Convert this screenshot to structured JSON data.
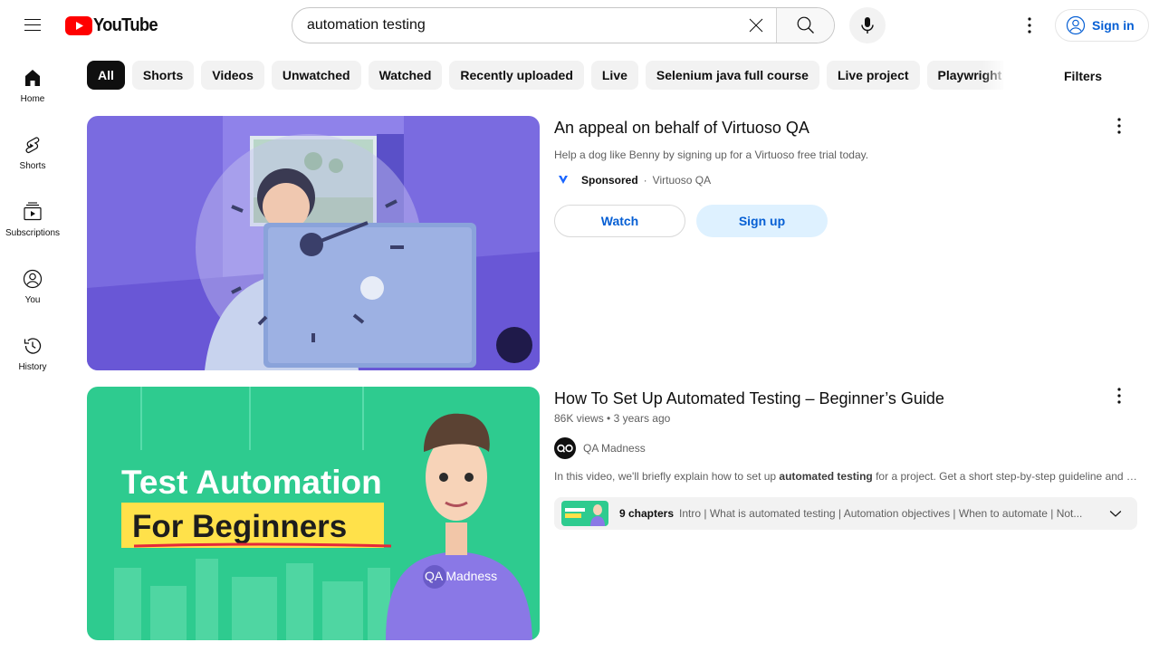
{
  "masthead": {
    "menu_icon": "hamburger-menu-icon",
    "logo_text": "YouTube",
    "brand_color": "#ff0000",
    "search": {
      "value": "automation testing",
      "placeholder": "Search"
    },
    "sign_in_label": "Sign in"
  },
  "guide": {
    "items": [
      {
        "label": "Home",
        "icon": "home-icon"
      },
      {
        "label": "Shorts",
        "icon": "shorts-icon"
      },
      {
        "label": "Subscriptions",
        "icon": "subscriptions-icon"
      },
      {
        "label": "You",
        "icon": "you-icon"
      },
      {
        "label": "History",
        "icon": "history-icon"
      }
    ]
  },
  "chips": [
    "All",
    "Shorts",
    "Videos",
    "Unwatched",
    "Watched",
    "Recently uploaded",
    "Live",
    "Selenium java full course",
    "Live project",
    "Playwright"
  ],
  "active_chip": "All",
  "filters_label": "Filters",
  "results": {
    "ad": {
      "title": "An appeal on behalf of Virtuoso QA",
      "description": "Help a dog like Benny by signing up for a Virtuoso free trial today.",
      "sponsored_label": "Sponsored",
      "advertiser": "Virtuoso QA",
      "watch_label": "Watch",
      "signup_label": "Sign up"
    },
    "video": {
      "title": "How To Set Up Automated Testing – Beginner’s Guide",
      "views": "86K views",
      "age": "3 years ago",
      "channel": "QA Madness",
      "description_before": "In this video, we'll briefly explain how to set up ",
      "description_bold": "automated testing",
      "description_after": " for a project. Get a short step-by-step guideline and a...",
      "thumbnail_line1": "Test Automation",
      "thumbnail_line2": "For Beginners",
      "thumbnail_brand": "QA Madness",
      "chapters_count": "9 chapters",
      "chapters_list": "Intro | What is automated testing | Automation objectives | When to automate | Not..."
    }
  }
}
